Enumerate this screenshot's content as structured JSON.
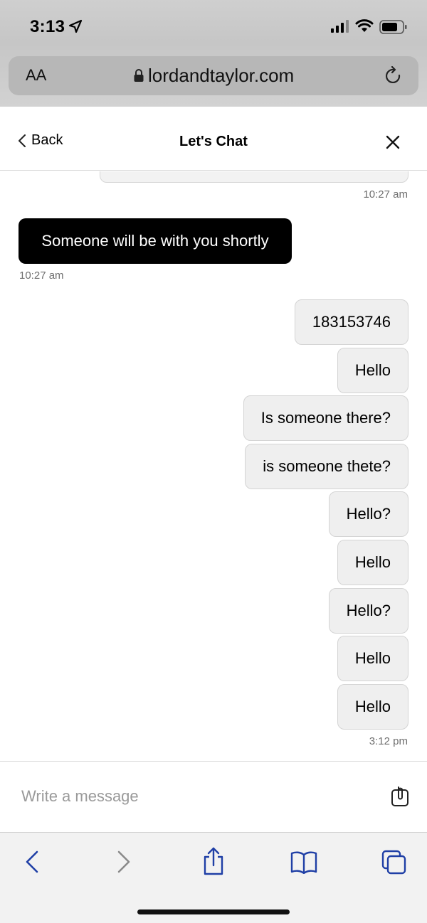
{
  "status_bar": {
    "time": "3:13"
  },
  "browser": {
    "text_size_label": "AA",
    "url": "lordandtaylor.com"
  },
  "chat_header": {
    "back_label": "Back",
    "title": "Let's Chat"
  },
  "messages": {
    "top_timestamp": "10:27 am",
    "agent_text": "Someone will be with you shortly",
    "agent_timestamp": "10:27 am",
    "user": [
      "183153746",
      "Hello",
      "Is someone there?",
      "is someone thete?",
      "Hello?",
      "Hello",
      "Hello?",
      "Hello",
      "Hello"
    ],
    "last_timestamp": "3:12 pm"
  },
  "compose": {
    "placeholder": "Write a message"
  },
  "colors": {
    "accent_blue": "#1f3fa6",
    "agent_bubble": "#000000",
    "user_bubble": "#efefef"
  },
  "icons": [
    "location-arrow-icon",
    "signal-icon",
    "wifi-icon",
    "battery-icon",
    "lock-icon",
    "reload-icon",
    "chevron-left-icon",
    "close-icon",
    "attach-icon",
    "back-icon",
    "forward-icon",
    "share-icon",
    "bookmarks-icon",
    "tabs-icon"
  ]
}
